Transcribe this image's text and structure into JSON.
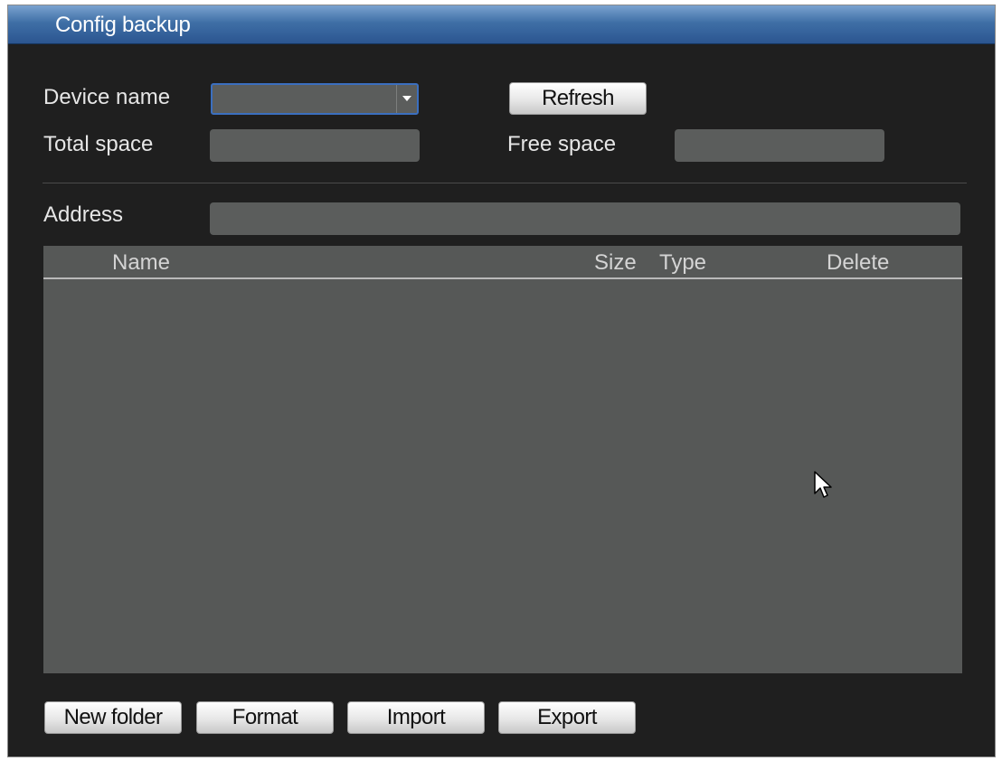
{
  "window": {
    "title": "Config backup"
  },
  "device": {
    "name_label": "Device name",
    "selected_value": "",
    "refresh_label": "Refresh",
    "total_space_label": "Total space",
    "total_space_value": "",
    "free_space_label": "Free space",
    "free_space_value": ""
  },
  "address": {
    "label": "Address",
    "value": ""
  },
  "file_table": {
    "columns": [
      "Name",
      "Size",
      "Type",
      "Delete"
    ],
    "rows": []
  },
  "footer": {
    "new_folder_label": "New folder",
    "format_label": "Format",
    "import_label": "Import",
    "export_label": "Export"
  },
  "icons": {
    "dropdown": "chevron-down-icon",
    "pointer": "mouse-cursor-icon"
  },
  "colors": {
    "title_bar": "#3f6fa6",
    "panel_background": "#1f1f1f",
    "field_background": "#5b5d5c",
    "focus_border": "#3b6fbf"
  }
}
